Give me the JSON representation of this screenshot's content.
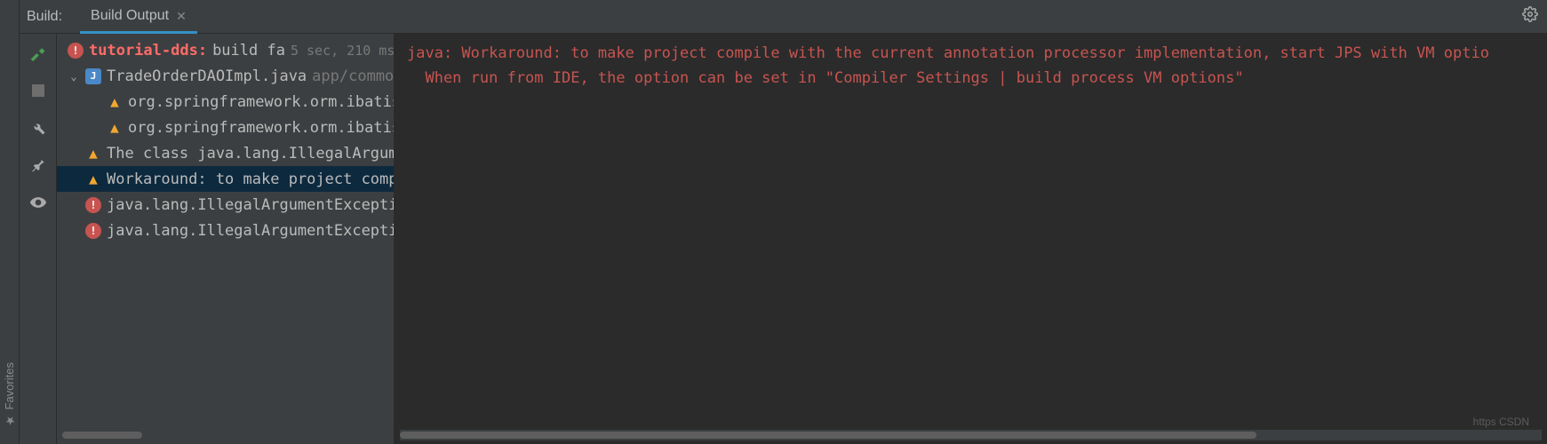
{
  "sidebar": {
    "favorites": "Favorites"
  },
  "tabbar": {
    "prefix": "Build:",
    "tab_label": "Build Output"
  },
  "tree": {
    "root_name": "tutorial-dds:",
    "root_status": "build fa",
    "root_timing": "5 sec, 210 ms",
    "file_name": "TradeOrderDAOImpl.java",
    "file_path": "app/common",
    "msg_warn1": "org.springframework.orm.ibatis",
    "msg_warn2": "org.springframework.orm.ibatis",
    "msg_warn3": "The class java.lang.IllegalArgume",
    "msg_warn4": "Workaround: to make project compi",
    "msg_err1": "java.lang.IllegalArgumentExceptio",
    "msg_err2": "java.lang.IllegalArgumentExceptio"
  },
  "output": {
    "line1": "java: Workaround: to make project compile with the current annotation processor implementation, start JPS with VM optio",
    "line2": "  When run from IDE, the option can be set in \"Compiler Settings | build process VM options\""
  },
  "watermark": "https CSDN"
}
